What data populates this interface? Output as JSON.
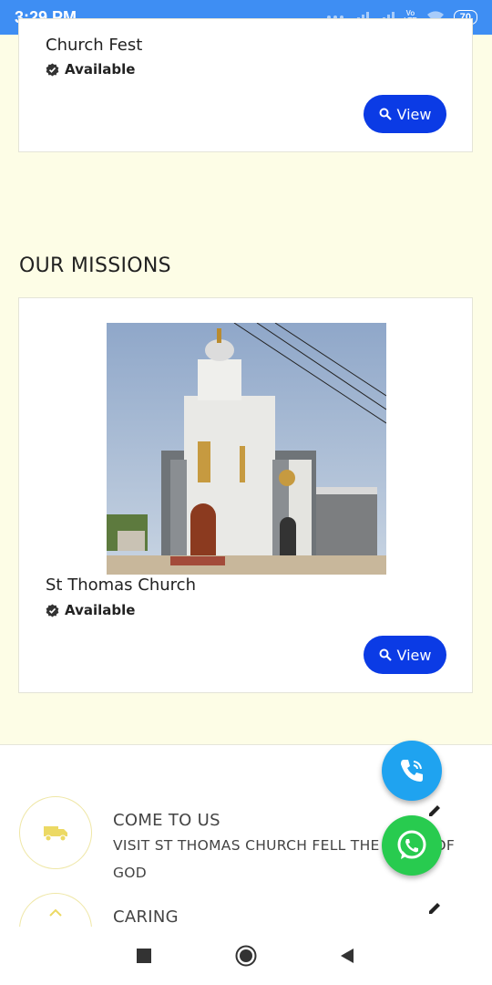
{
  "status_bar": {
    "time": "3:29 PM",
    "battery": "70",
    "network": "Vo LTE"
  },
  "events": {
    "card": {
      "title": "Church Fest",
      "status": "Available",
      "button_label": "View"
    }
  },
  "missions": {
    "heading": "OUR MISSIONS",
    "card": {
      "title": "St Thomas Church",
      "status": "Available",
      "button_label": "View"
    }
  },
  "features": [
    {
      "title": "COME TO US",
      "description": "VISIT ST THOMAS CHURCH FELL THE BLESS OF GOD",
      "icon": "truck-icon"
    },
    {
      "title": "CARING",
      "icon": "chevron-up-icon"
    }
  ],
  "fabs": [
    {
      "name": "phone",
      "color": "#1fa3f0"
    },
    {
      "name": "whatsapp",
      "color": "#28cb4f"
    }
  ],
  "colors": {
    "page_bg": "#fdfde6",
    "status_bar": "#3e8ef3",
    "button": "#0b3be5"
  }
}
